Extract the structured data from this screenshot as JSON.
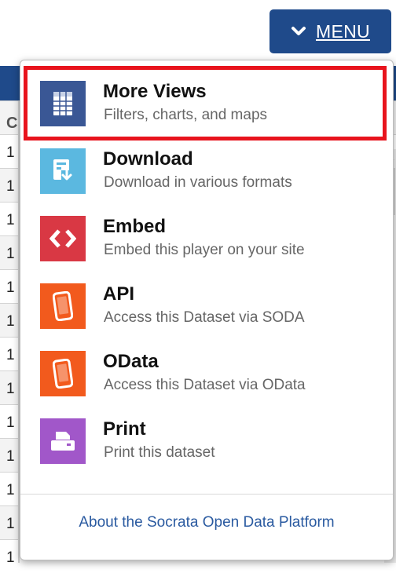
{
  "menu_button": {
    "label": "MENU",
    "icon": "chevron-down-icon"
  },
  "background": {
    "row_number": "1",
    "column_overlay": "C"
  },
  "dropdown": {
    "items": [
      {
        "title": "More Views",
        "description": "Filters, charts, and maps",
        "icon": "table-icon",
        "color": "#3a5795",
        "highlighted": true
      },
      {
        "title": "Download",
        "description": "Download in various formats",
        "icon": "download-icon",
        "color": "#5bb8e0"
      },
      {
        "title": "Embed",
        "description": "Embed this player on your site",
        "icon": "embed-icon",
        "color": "#d93844"
      },
      {
        "title": "API",
        "description": "Access this Dataset via SODA",
        "icon": "phone-icon",
        "color": "#f25a1d"
      },
      {
        "title": "OData",
        "description": "Access this Dataset via OData",
        "icon": "phone-icon",
        "color": "#f25a1d"
      },
      {
        "title": "Print",
        "description": "Print this dataset",
        "icon": "printer-icon",
        "color": "#a157c9"
      }
    ],
    "footer_link": "About the Socrata Open Data Platform"
  },
  "colors": {
    "brand_blue": "#1f4a8a",
    "highlight_red": "#e8141d",
    "link_blue": "#2a5aa0"
  }
}
